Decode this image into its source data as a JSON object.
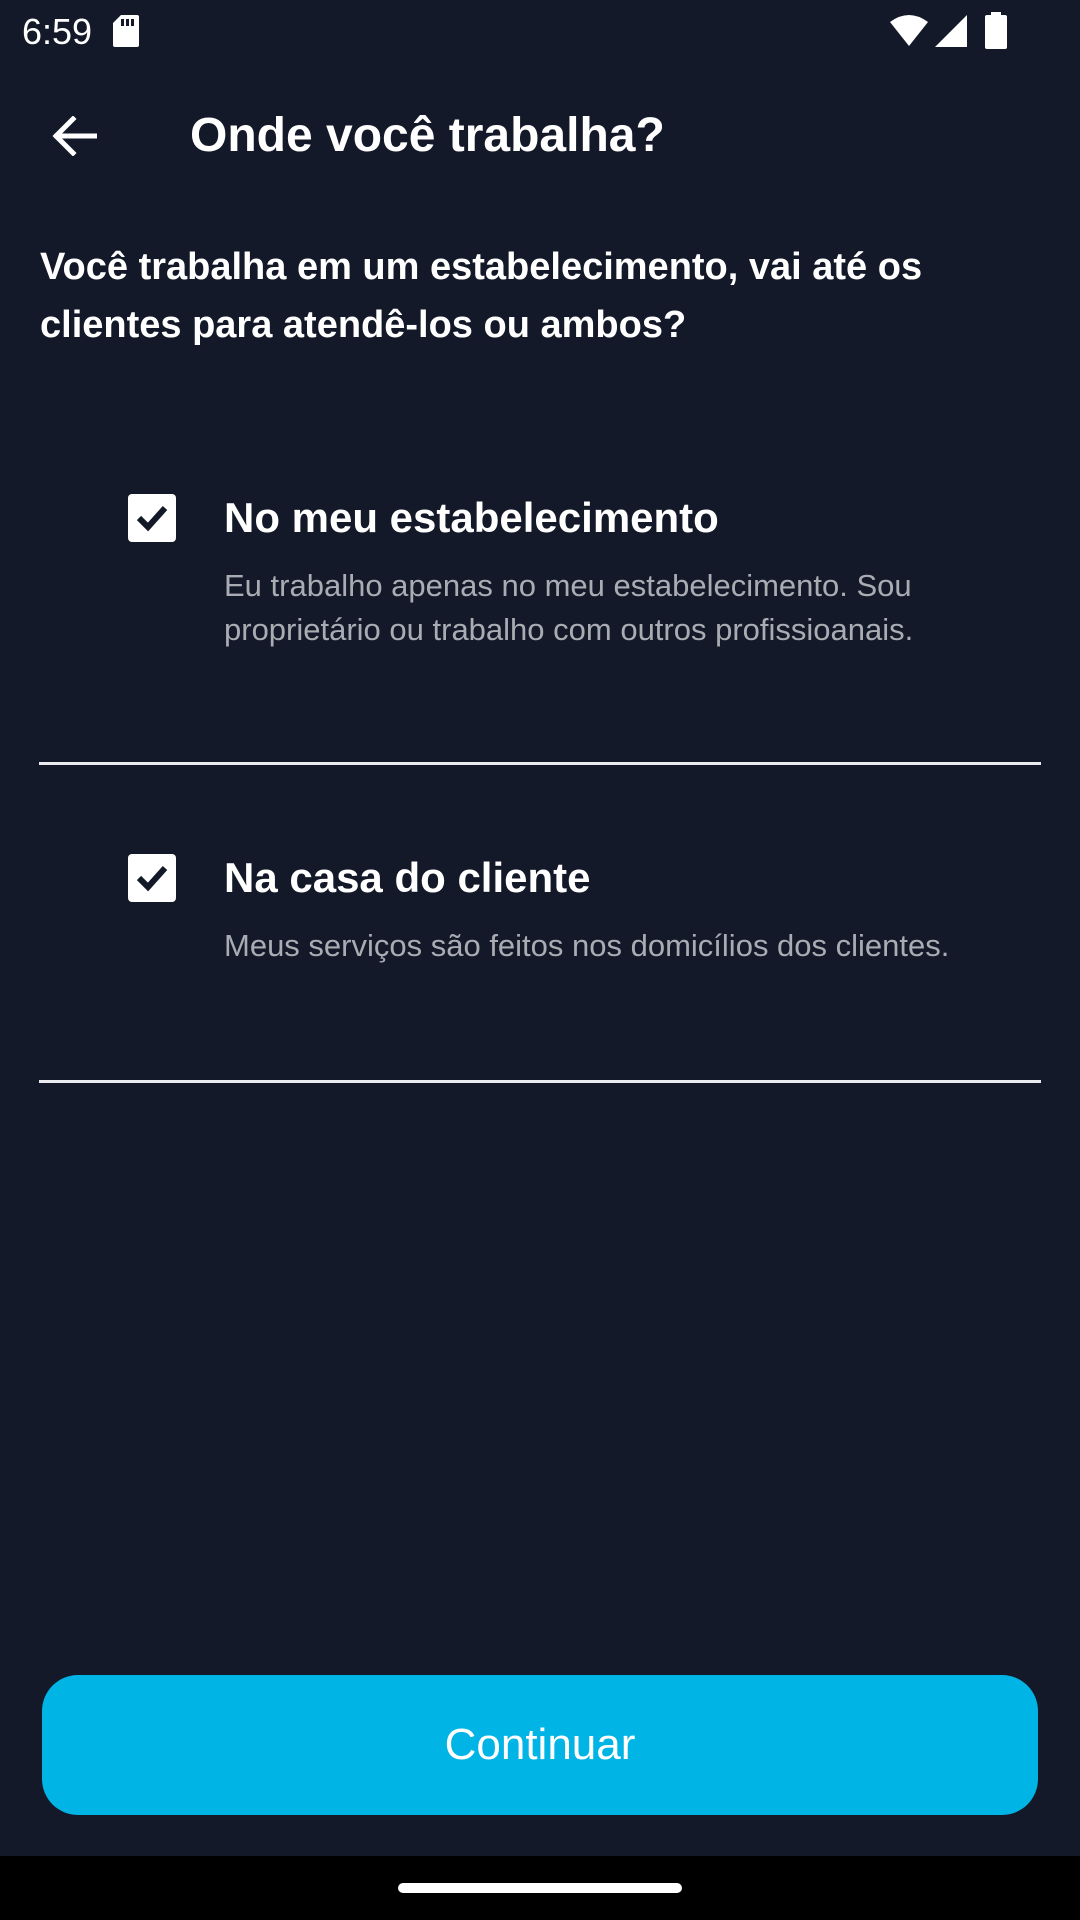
{
  "status_bar": {
    "time": "6:59",
    "icons": [
      "sd-card-icon",
      "wifi-icon",
      "signal-icon",
      "battery-icon"
    ]
  },
  "header": {
    "title": "Onde você trabalha?",
    "back_icon": "arrow-left-icon"
  },
  "question": "Você trabalha em um estabelecimento, vai até os clientes para atendê-los ou ambos?",
  "options": [
    {
      "title": "No meu estabelecimento",
      "description": "Eu trabalho apenas no meu estabelecimento. Sou proprietário ou trabalho com outros profissioanais.",
      "checked": true
    },
    {
      "title": "Na casa do cliente",
      "description": "Meus serviços são feitos nos domicílios dos clientes.",
      "checked": true
    }
  ],
  "continue_label": "Continuar",
  "colors": {
    "background": "#131928",
    "accent": "#00b4e6",
    "text": "#ffffff",
    "muted_text": "#a9acb3"
  }
}
